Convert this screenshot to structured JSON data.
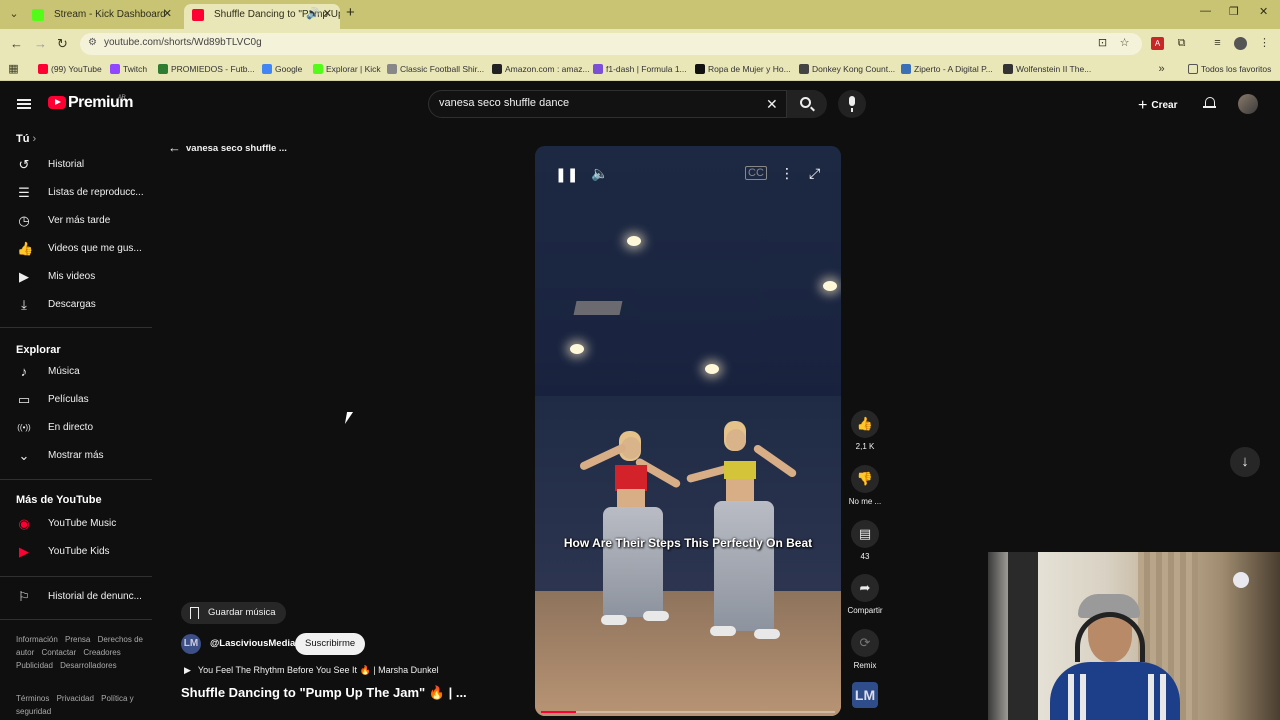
{
  "browser": {
    "tabs": [
      {
        "title": "Stream - Kick Dashboard",
        "favicon_color": "#53fc18"
      },
      {
        "title": "Shuffle Dancing to \"Pump Up",
        "favicon_color": "#ff0033"
      }
    ],
    "url": "youtube.com/shorts/Wd89bTLVC0g",
    "bookmarks": [
      {
        "label": "(99) YouTube",
        "color": "#ff0033"
      },
      {
        "label": "Twitch",
        "color": "#9146ff"
      },
      {
        "label": "PROMIEDOS - Futb...",
        "color": "#2e7d32"
      },
      {
        "label": "Google",
        "color": "#4285f4"
      },
      {
        "label": "Explorar | Kick",
        "color": "#53fc18"
      },
      {
        "label": "Classic Football Shir...",
        "color": "#888888"
      },
      {
        "label": "Amazon.com : amaz...",
        "color": "#222222"
      },
      {
        "label": "f1-dash | Formula 1...",
        "color": "#7b4fd6"
      },
      {
        "label": "Ropa de Mujer y Ho...",
        "color": "#111111"
      },
      {
        "label": "Donkey Kong Count...",
        "color": "#444444"
      },
      {
        "label": "Ziperto - A Digital P...",
        "color": "#3b6fb6"
      },
      {
        "label": "Wolfenstein II The...",
        "color": "#333333"
      }
    ],
    "all_bookmarks": "Todos los favoritos"
  },
  "header": {
    "brand": "Premium",
    "brand_country": "AR",
    "search_value": "vanesa seco shuffle dance",
    "create_label": "Crear"
  },
  "sidebar": {
    "you_label": "Tú",
    "you_items": [
      {
        "label": "Historial",
        "icon": "history-icon",
        "glyph": "↺"
      },
      {
        "label": "Listas de reproducc...",
        "icon": "playlist-icon",
        "glyph": "☰"
      },
      {
        "label": "Ver más tarde",
        "icon": "clock-icon",
        "glyph": "◷"
      },
      {
        "label": "Videos que me gus...",
        "icon": "like-icon",
        "glyph": "👍"
      },
      {
        "label": "Mis videos",
        "icon": "my-videos-icon",
        "glyph": "▶"
      },
      {
        "label": "Descargas",
        "icon": "download-icon",
        "glyph": "⤓"
      }
    ],
    "explore_label": "Explorar",
    "explore_items": [
      {
        "label": "Música",
        "icon": "music-icon",
        "glyph": "♪"
      },
      {
        "label": "Películas",
        "icon": "movies-icon",
        "glyph": "▭"
      },
      {
        "label": "En directo",
        "icon": "live-icon",
        "glyph": "((•))"
      },
      {
        "label": "Mostrar más",
        "icon": "chevron-down-icon",
        "glyph": "⌄"
      }
    ],
    "more_label": "Más de YouTube",
    "more_items": [
      {
        "label": "YouTube Music",
        "icon": "youtube-music-icon",
        "glyph": "◉"
      },
      {
        "label": "YouTube Kids",
        "icon": "youtube-kids-icon",
        "glyph": "▶"
      }
    ],
    "report_label": "Historial de denunc...",
    "footer_line1": [
      "Información",
      "Prensa",
      "Derechos de autor",
      "Contactar",
      "Creadores",
      "Publicidad",
      "Desarrolladores"
    ],
    "footer_line2": [
      "Términos",
      "Privacidad",
      "Política y seguridad"
    ]
  },
  "shorts": {
    "back_title": "vanesa seco shuffle ...",
    "caption": "How Are Their Steps This Perfectly On Beat",
    "progress": 0.12,
    "likes": "2,1 K",
    "dislike_label": "No me ...",
    "comments": "43",
    "share_label": "Compartir",
    "remix_label": "Remix",
    "channel_thumb": "LM",
    "save_music_label": "Guardar música",
    "channel": "@LasciviousMedia",
    "subscribe_label": "Suscribirme",
    "music": "You Feel The Rhythm Before You See It 🔥 | Marsha Dunkel",
    "title": "Shuffle Dancing to \"Pump Up The Jam\" 🔥 | ..."
  }
}
